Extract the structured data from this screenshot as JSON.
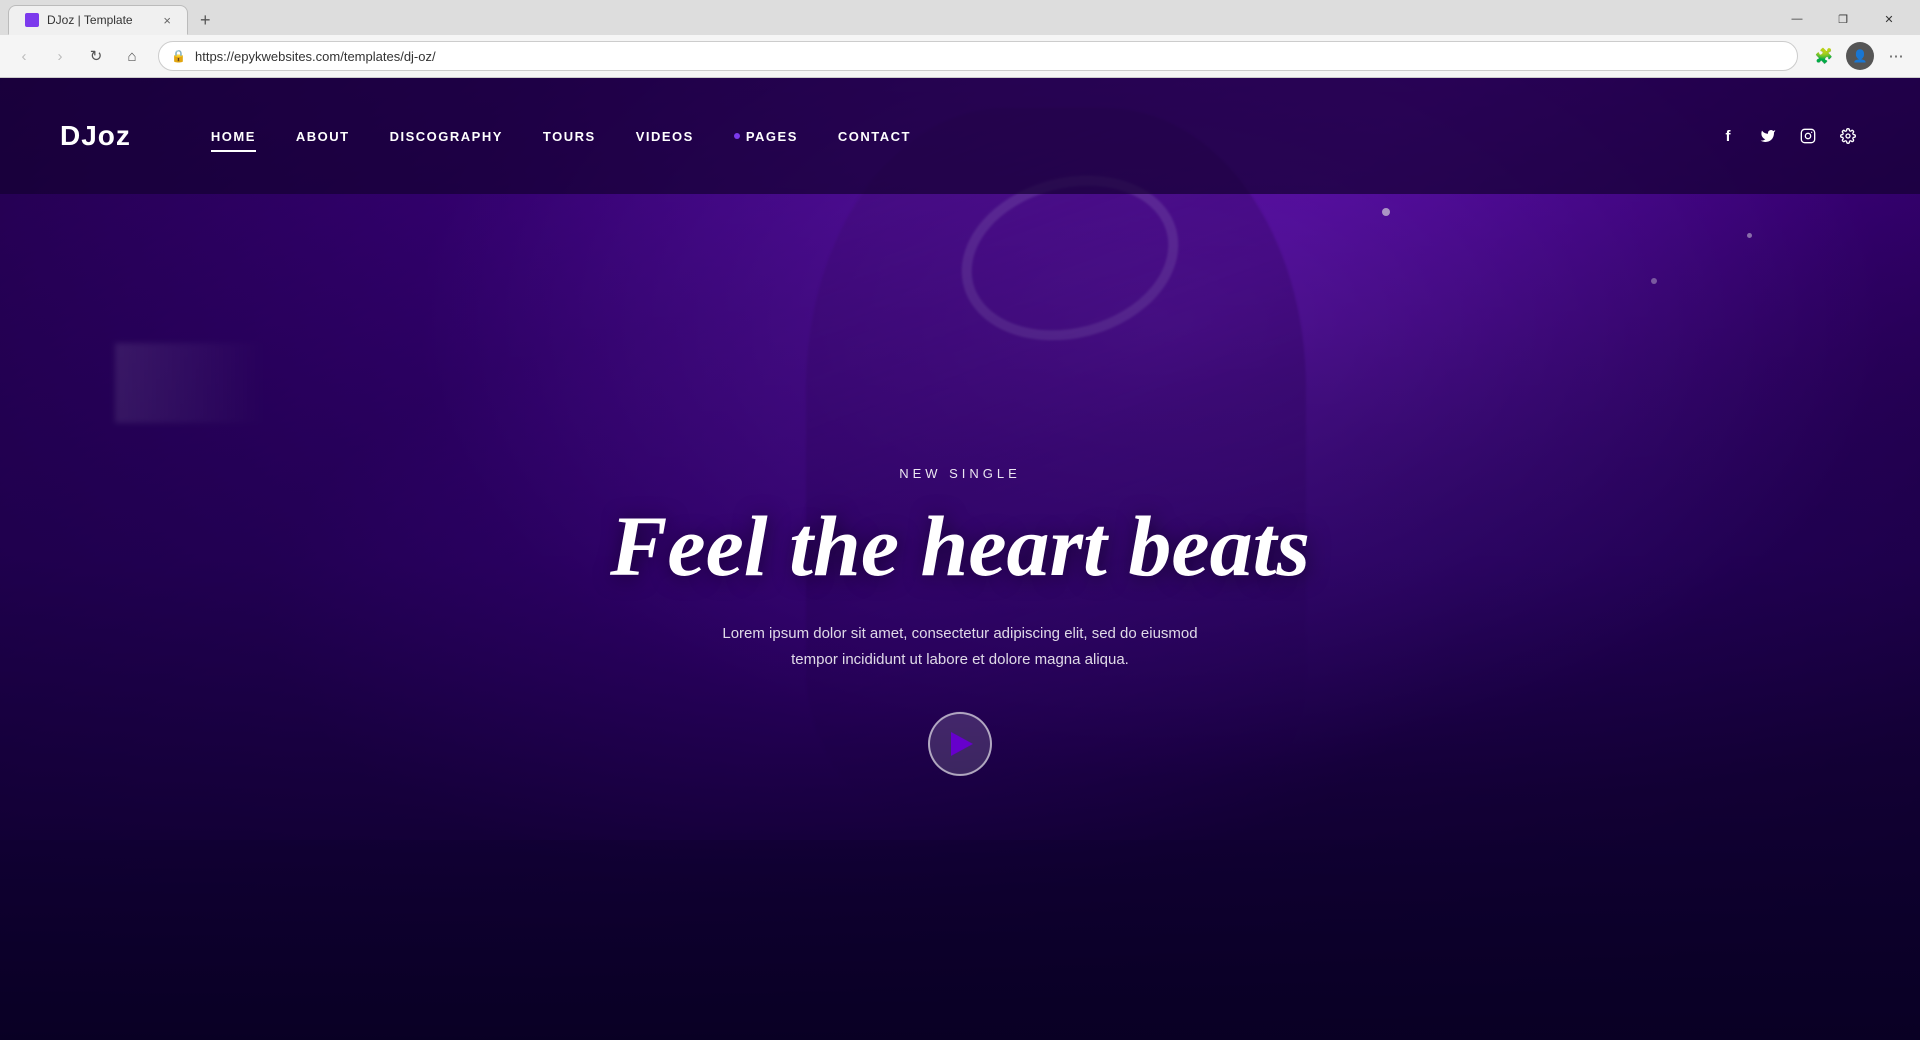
{
  "browser": {
    "tab_title": "DJoz | Template",
    "tab_close": "×",
    "new_tab": "+",
    "url": "https://epykwebsites.com/templates/dj-oz/",
    "back_btn": "‹",
    "forward_btn": "›",
    "refresh_btn": "↻",
    "home_btn": "⌂",
    "extensions_icon": "🧩",
    "profile_icon": "👤",
    "menu_icon": "⋯",
    "minimize": "—",
    "restore": "❐",
    "close": "✕"
  },
  "site": {
    "logo": "DJoz",
    "nav": {
      "items": [
        {
          "label": "HOME",
          "active": true,
          "has_dot": false
        },
        {
          "label": "ABOUT",
          "active": false,
          "has_dot": false
        },
        {
          "label": "DISCOGRAPHY",
          "active": false,
          "has_dot": false
        },
        {
          "label": "TOURS",
          "active": false,
          "has_dot": false
        },
        {
          "label": "VIDEOS",
          "active": false,
          "has_dot": false
        },
        {
          "label": "PAGES",
          "active": false,
          "has_dot": true
        },
        {
          "label": "CONTACT",
          "active": false,
          "has_dot": false
        }
      ]
    },
    "social": {
      "facebook": "f",
      "twitter": "t",
      "instagram": "◉",
      "settings": "⚙"
    },
    "hero": {
      "subtitle": "NEW SINGLE",
      "title": "Feel the heart beats",
      "description": "Lorem ipsum dolor sit amet, consectetur adipiscing elit, sed do eiusmod tempor incididunt ut labore et dolore magna aliqua.",
      "play_label": "Play"
    }
  }
}
